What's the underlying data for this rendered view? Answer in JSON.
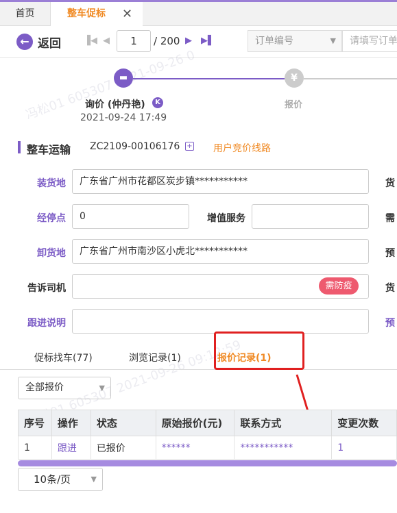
{
  "tabs": {
    "home": "首页",
    "active": "整车促标",
    "close": "✕"
  },
  "toolbar": {
    "back": "返回",
    "page_current": "1",
    "page_total": "/ 200",
    "order_select": "订单编号",
    "search_placeholder": "请填写订单"
  },
  "steps": {
    "step1_label": "询价 (仲丹艳)",
    "step1_badge": "K",
    "step1_time": "2021-09-24 17:49",
    "step2_label": "报价",
    "step2_icon": "¥"
  },
  "section": {
    "title": "整车运输",
    "order_no": "ZC2109-00106176",
    "route_link": "用户竞价线路"
  },
  "form": {
    "load_label": "装货地",
    "load_value": "广东省广州市花都区炭步镇***********",
    "load_side": "货",
    "stop_label": "经停点",
    "stop_value": "0",
    "vas_label": "增值服务",
    "vas_value": "",
    "stop_side": "需",
    "unload_label": "卸货地",
    "unload_value": "广东省广州市南沙区小虎北***********",
    "unload_side": "预",
    "driver_label": "告诉司机",
    "driver_tag": "需防疫",
    "driver_side": "货",
    "follow_label": "跟进说明",
    "follow_side": "预"
  },
  "sub_tabs": {
    "t1": "促标找车(77)",
    "t2": "浏览记录(1)",
    "t3": "报价记录(1)"
  },
  "filter": {
    "value": "全部报价"
  },
  "table": {
    "headers": [
      "序号",
      "操作",
      "状态",
      "原始报价(元)",
      "联系方式",
      "变更次数"
    ],
    "rows": [
      [
        "1",
        "跟进",
        "已报价",
        "******",
        "***********",
        "1"
      ]
    ]
  },
  "pager": {
    "value": "10条/页"
  },
  "colors": {
    "accent": "#7c5cc6",
    "orange": "#f08a24",
    "tag": "#ee5a6f",
    "highlight": "#e02020"
  }
}
